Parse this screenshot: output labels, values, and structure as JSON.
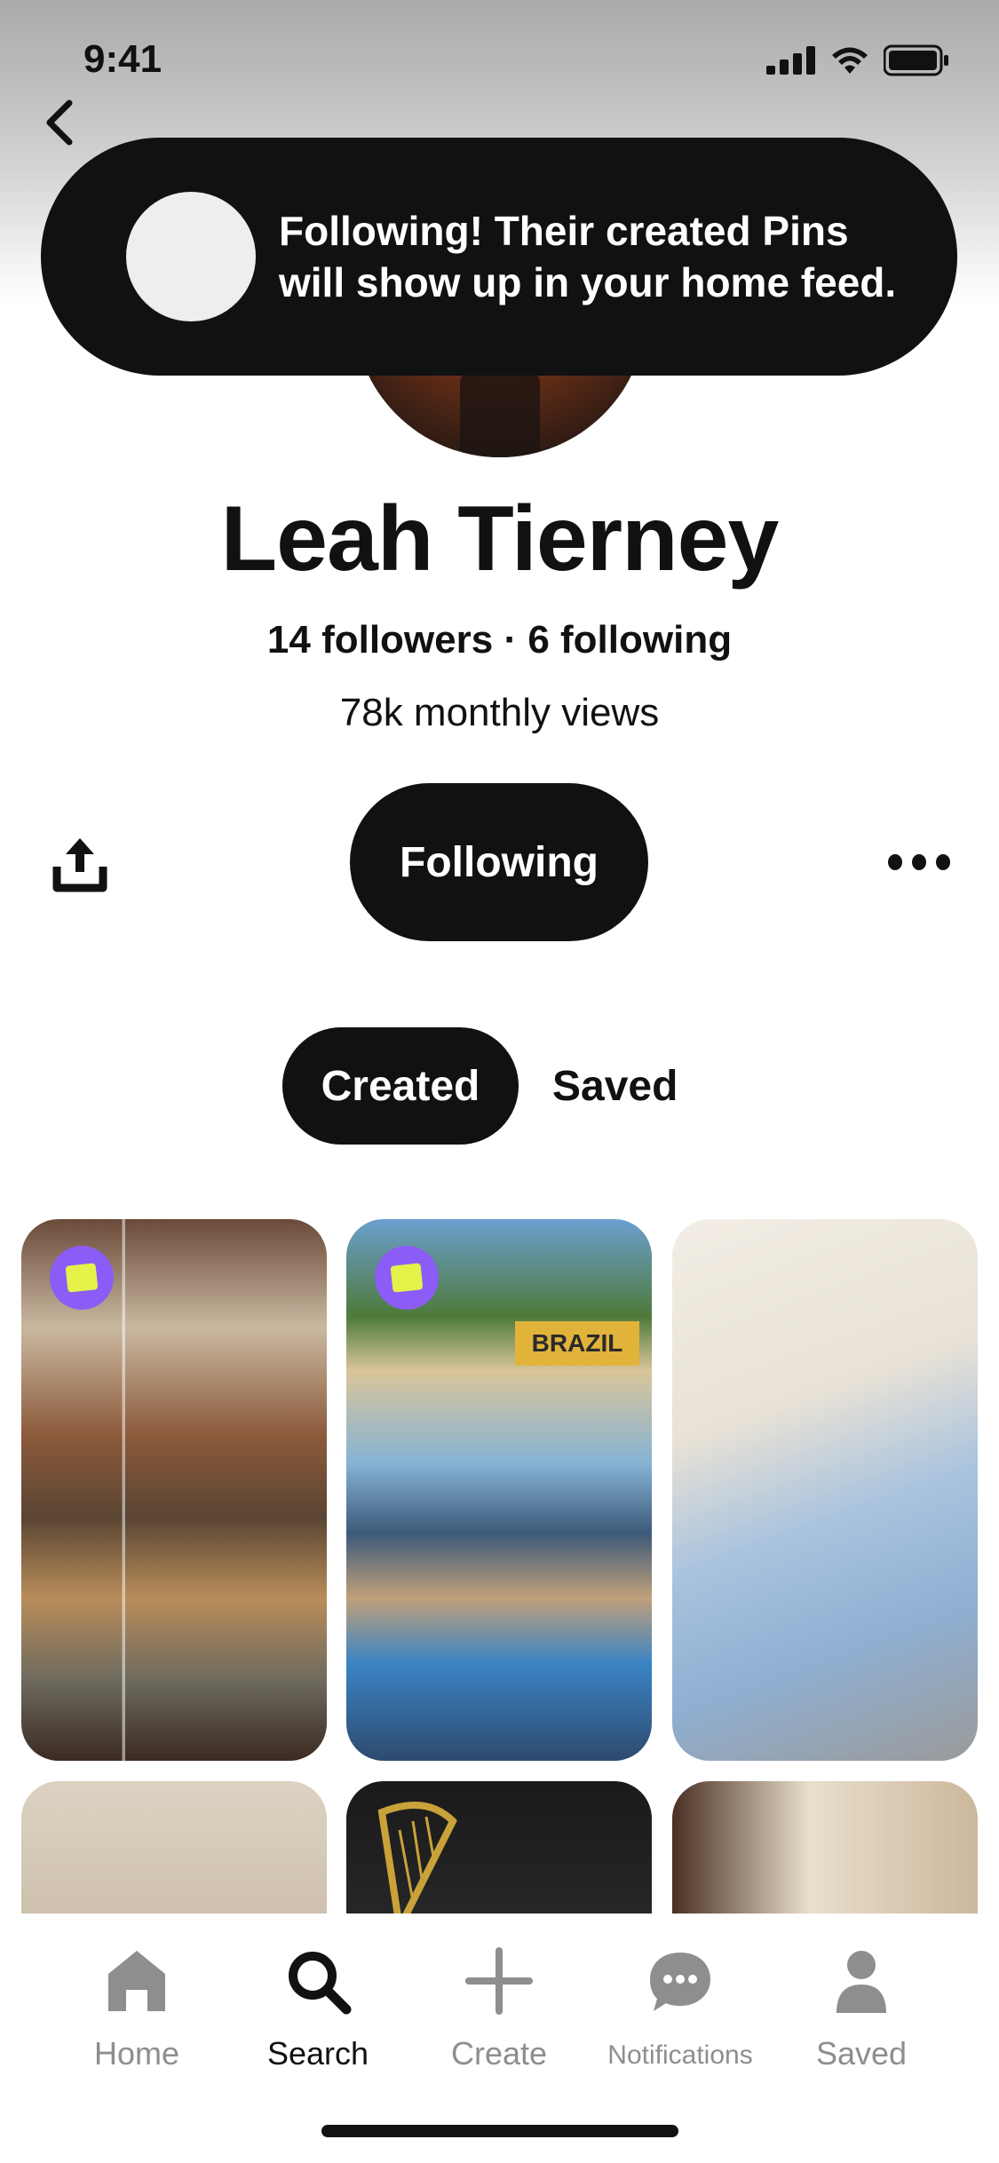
{
  "status_bar": {
    "time": "9:41"
  },
  "toast": {
    "message": "Following! Their created Pins will show up in your home feed."
  },
  "profile": {
    "name": "Leah Tierney",
    "stats": "14 followers · 6 following",
    "views": "78k monthly views"
  },
  "actions": {
    "follow_label": "Following"
  },
  "tabs": {
    "created": "Created",
    "saved": "Saved"
  },
  "pins": {
    "brazil_sign": "BRAZIL"
  },
  "tabbar": {
    "items": [
      {
        "label": "Home"
      },
      {
        "label": "Search"
      },
      {
        "label": "Create"
      },
      {
        "label": "Notifications"
      },
      {
        "label": "Saved"
      }
    ],
    "active": "Search"
  }
}
